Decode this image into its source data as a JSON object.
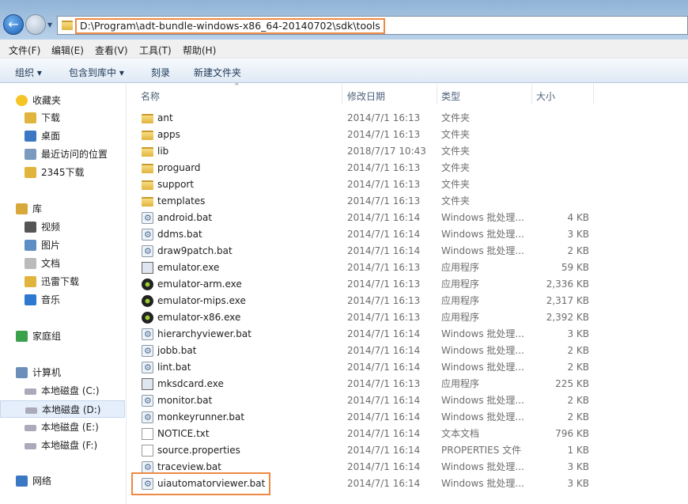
{
  "address": {
    "path": "D:\\Program\\adt-bundle-windows-x86_64-20140702\\sdk\\tools"
  },
  "menu": [
    "文件(F)",
    "编辑(E)",
    "查看(V)",
    "工具(T)",
    "帮助(H)"
  ],
  "toolbar": {
    "organize": "组织 ▾",
    "include": "包含到库中 ▾",
    "burn": "刻录",
    "new_folder": "新建文件夹"
  },
  "sidebar": [
    {
      "label": "收藏夹",
      "icon": "star-icon"
    },
    {
      "label": "下载",
      "icon": "download-folder-icon"
    },
    {
      "label": "桌面",
      "icon": "desktop-icon"
    },
    {
      "label": "最近访问的位置",
      "icon": "recent-icon"
    },
    {
      "label": "2345下载",
      "icon": "folder-icon"
    },
    {
      "label": "库",
      "icon": "library-icon"
    },
    {
      "label": "视频",
      "icon": "video-icon"
    },
    {
      "label": "图片",
      "icon": "picture-icon"
    },
    {
      "label": "文档",
      "icon": "document-icon"
    },
    {
      "label": "迅雷下载",
      "icon": "folder-icon"
    },
    {
      "label": "音乐",
      "icon": "music-icon"
    },
    {
      "label": "家庭组",
      "icon": "homegroup-icon"
    },
    {
      "label": "计算机",
      "icon": "computer-icon"
    },
    {
      "label": "本地磁盘 (C:)",
      "icon": "drive-icon"
    },
    {
      "label": "本地磁盘 (D:)",
      "icon": "drive-icon",
      "selected": true
    },
    {
      "label": "本地磁盘 (E:)",
      "icon": "drive-icon"
    },
    {
      "label": "本地磁盘 (F:)",
      "icon": "drive-icon"
    },
    {
      "label": "网络",
      "icon": "network-icon"
    }
  ],
  "columns": [
    "名称",
    "修改日期",
    "类型",
    "大小"
  ],
  "files": [
    {
      "name": "ant",
      "date": "2014/7/1 16:13",
      "type": "文件夹",
      "size": "",
      "icon": "folder"
    },
    {
      "name": "apps",
      "date": "2014/7/1 16:13",
      "type": "文件夹",
      "size": "",
      "icon": "folder"
    },
    {
      "name": "lib",
      "date": "2018/7/17 10:43",
      "type": "文件夹",
      "size": "",
      "icon": "folder"
    },
    {
      "name": "proguard",
      "date": "2014/7/1 16:13",
      "type": "文件夹",
      "size": "",
      "icon": "folder"
    },
    {
      "name": "support",
      "date": "2014/7/1 16:13",
      "type": "文件夹",
      "size": "",
      "icon": "folder"
    },
    {
      "name": "templates",
      "date": "2014/7/1 16:13",
      "type": "文件夹",
      "size": "",
      "icon": "folder"
    },
    {
      "name": "android.bat",
      "date": "2014/7/1 16:14",
      "type": "Windows 批处理...",
      "size": "4 KB",
      "icon": "bat"
    },
    {
      "name": "ddms.bat",
      "date": "2014/7/1 16:14",
      "type": "Windows 批处理...",
      "size": "3 KB",
      "icon": "bat"
    },
    {
      "name": "draw9patch.bat",
      "date": "2014/7/1 16:14",
      "type": "Windows 批处理...",
      "size": "2 KB",
      "icon": "bat"
    },
    {
      "name": "emulator.exe",
      "date": "2014/7/1 16:13",
      "type": "应用程序",
      "size": "59 KB",
      "icon": "exe1"
    },
    {
      "name": "emulator-arm.exe",
      "date": "2014/7/1 16:13",
      "type": "应用程序",
      "size": "2,336 KB",
      "icon": "exe"
    },
    {
      "name": "emulator-mips.exe",
      "date": "2014/7/1 16:13",
      "type": "应用程序",
      "size": "2,317 KB",
      "icon": "exe"
    },
    {
      "name": "emulator-x86.exe",
      "date": "2014/7/1 16:13",
      "type": "应用程序",
      "size": "2,392 KB",
      "icon": "exe"
    },
    {
      "name": "hierarchyviewer.bat",
      "date": "2014/7/1 16:14",
      "type": "Windows 批处理...",
      "size": "3 KB",
      "icon": "bat"
    },
    {
      "name": "jobb.bat",
      "date": "2014/7/1 16:14",
      "type": "Windows 批处理...",
      "size": "2 KB",
      "icon": "bat"
    },
    {
      "name": "lint.bat",
      "date": "2014/7/1 16:14",
      "type": "Windows 批处理...",
      "size": "2 KB",
      "icon": "bat"
    },
    {
      "name": "mksdcard.exe",
      "date": "2014/7/1 16:13",
      "type": "应用程序",
      "size": "225 KB",
      "icon": "exe1"
    },
    {
      "name": "monitor.bat",
      "date": "2014/7/1 16:14",
      "type": "Windows 批处理...",
      "size": "2 KB",
      "icon": "bat"
    },
    {
      "name": "monkeyrunner.bat",
      "date": "2014/7/1 16:14",
      "type": "Windows 批处理...",
      "size": "2 KB",
      "icon": "bat"
    },
    {
      "name": "NOTICE.txt",
      "date": "2014/7/1 16:14",
      "type": "文本文档",
      "size": "796 KB",
      "icon": "txt"
    },
    {
      "name": "source.properties",
      "date": "2014/7/1 16:14",
      "type": "PROPERTIES 文件",
      "size": "1 KB",
      "icon": "txt"
    },
    {
      "name": "traceview.bat",
      "date": "2014/7/1 16:14",
      "type": "Windows 批处理...",
      "size": "3 KB",
      "icon": "bat"
    },
    {
      "name": "uiautomatorviewer.bat",
      "date": "2014/7/1 16:14",
      "type": "Windows 批处理...",
      "size": "3 KB",
      "icon": "bat",
      "highlighted": true
    }
  ],
  "colors": {
    "highlight": "#ee8a45",
    "selection": "#e5eefb"
  }
}
